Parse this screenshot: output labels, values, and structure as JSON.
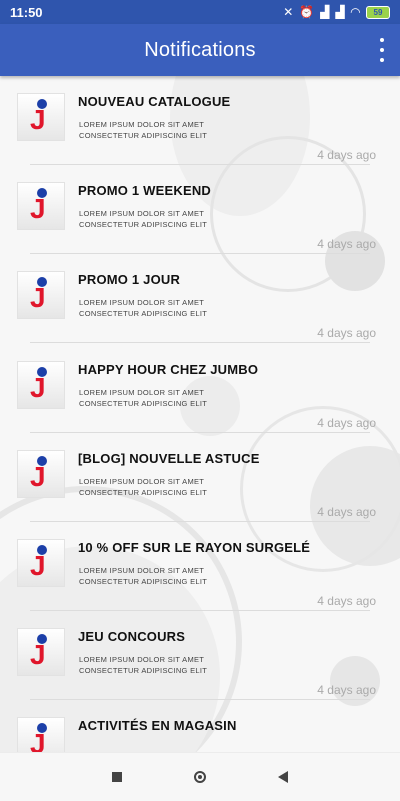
{
  "status_bar": {
    "time": "11:50",
    "battery": "59",
    "icons": [
      "mute-icon",
      "alarm-icon",
      "signal-icon",
      "signal-icon",
      "wifi-icon",
      "battery-icon"
    ]
  },
  "app_bar": {
    "title": "Notifications",
    "menu_icon": "more-vert-icon"
  },
  "notifications": [
    {
      "title": "NOUVEAU CATALOGUE",
      "body": "LOREM IPSUM DOLOR SIT AMET\nCONSECTETUR ADIPISCING ELIT",
      "time": "4 days ago"
    },
    {
      "title": "PROMO 1 WEEKEND",
      "body": "LOREM IPSUM DOLOR SIT AMET\nCONSECTETUR ADIPISCING ELIT",
      "time": "4 days ago"
    },
    {
      "title": "PROMO 1 JOUR",
      "body": "LOREM IPSUM DOLOR SIT AMET\nCONSECTETUR ADIPISCING ELIT",
      "time": "4 days ago"
    },
    {
      "title": "HAPPY HOUR CHEZ JUMBO",
      "body": "LOREM IPSUM DOLOR SIT AMET\nCONSECTETUR ADIPISCING ELIT",
      "time": "4 days ago"
    },
    {
      "title": "[BLOG] NOUVELLE ASTUCE",
      "body": "LOREM IPSUM DOLOR SIT AMET\nCONSECTETUR ADIPISCING ELIT",
      "time": "4 days ago"
    },
    {
      "title": "10 % OFF SUR LE RAYON SURGELÉ",
      "body": "LOREM IPSUM DOLOR SIT AMET\nCONSECTETUR ADIPISCING ELIT",
      "time": "4 days ago"
    },
    {
      "title": "JEU CONCOURS",
      "body": "LOREM IPSUM DOLOR SIT AMET\nCONSECTETUR ADIPISCING ELIT",
      "time": "4 days ago"
    },
    {
      "title": "ACTIVITÉS EN MAGASIN",
      "body": "",
      "time": ""
    }
  ],
  "logo": {
    "letter": "J",
    "letter_color": "#e0162b",
    "dot_color": "#1c3fa8"
  },
  "colors": {
    "app_bar": "#3a5fbd",
    "status_bar": "#2f55ad",
    "title_text": "#111111",
    "time_text": "#aaaaaa"
  },
  "nav_bar": {
    "icons": [
      "recent-apps-icon",
      "home-icon",
      "back-icon"
    ]
  }
}
